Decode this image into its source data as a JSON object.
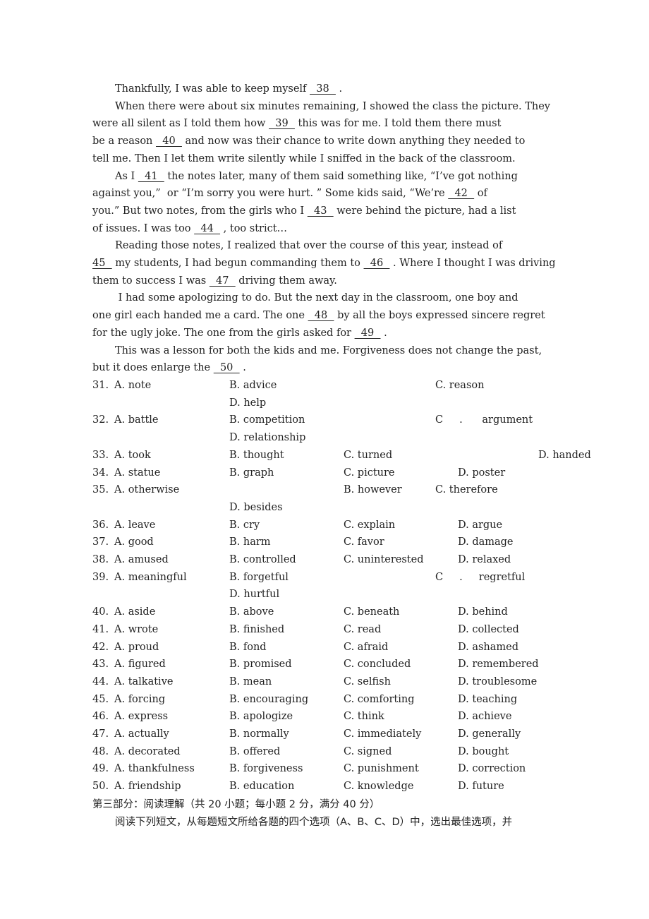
{
  "passage": {
    "lines": [
      {
        "indent": true,
        "parts": [
          "Thankfully, I was able to keep myself ",
          "  38  ",
          " ."
        ]
      },
      {
        "indent": true,
        "parts": [
          "When there were about six minutes remaining, I showed the class the picture. They"
        ]
      },
      {
        "indent": false,
        "parts": [
          "were all silent as I told them how ",
          "  39  ",
          " this was for me. I told them there must"
        ]
      },
      {
        "indent": false,
        "parts": [
          "be a reason ",
          "  40  ",
          " and now was their chance to write down anything they needed to"
        ]
      },
      {
        "indent": false,
        "parts": [
          "tell me. Then I let them write silently while I sniffed in the back of the classroom."
        ]
      },
      {
        "indent": true,
        "parts": [
          "As I ",
          "  41  ",
          " the notes later, many of them said something like, “I’ve got nothing"
        ]
      },
      {
        "indent": false,
        "parts": [
          "against you,”  or “I’m sorry you were hurt. ” Some kids said, “We’re ",
          "  42  ",
          " of"
        ]
      },
      {
        "indent": false,
        "parts": [
          "you.” But two notes, from the girls who I ",
          "  43  ",
          " were behind the picture, had a list"
        ]
      },
      {
        "indent": false,
        "parts": [
          "of issues. I was too ",
          "  44  ",
          " , too strict…"
        ]
      },
      {
        "indent": true,
        "parts": [
          "Reading those notes, I realized that over the course of this year, instead of"
        ]
      },
      {
        "indent": false,
        "parts": [
          "",
          "45  ",
          " my students, I had begun commanding them to ",
          "  46  ",
          " . Where I thought I was driving"
        ]
      },
      {
        "indent": false,
        "parts": [
          "them to success I was ",
          "  47  ",
          " driving them away."
        ]
      },
      {
        "indent": true,
        "parts": [
          " I had some apologizing to do. But the next day in the classroom, one boy and"
        ]
      },
      {
        "indent": false,
        "parts": [
          "one girl each handed me a card. The one ",
          "  48  ",
          " by all the boys expressed sincere regret"
        ]
      },
      {
        "indent": false,
        "parts": [
          "for the ugly joke. The one from the girls asked for ",
          "  49  ",
          " ."
        ]
      },
      {
        "indent": true,
        "parts": [
          "This was a lesson for both the kids and me. Forgiveness does not change the past,"
        ]
      },
      {
        "indent": false,
        "parts": [
          "but it does enlarge the ",
          "  50  ",
          " ."
        ]
      }
    ]
  },
  "questions": [
    {
      "num": "31.",
      "A": "A. note",
      "B": "B. advice",
      "C": "C. reason",
      "D": "D. help",
      "layout": "wrapCD"
    },
    {
      "num": "32.",
      "A": "A. battle",
      "B": "B. competition",
      "C": "C     .      argument",
      "D": "D. relationship",
      "layout": "wrapCD"
    },
    {
      "num": "33.",
      "A": "A. took",
      "B": "B. thought",
      "C": "C. turned",
      "D": "D. handed",
      "layout": "farD"
    },
    {
      "num": "34.",
      "A": "A. statue",
      "B": "B. graph",
      "C": "C. picture",
      "D": "D. poster",
      "layout": "normal"
    },
    {
      "num": "35.",
      "A": "A. otherwise",
      "B": "B. however",
      "C": "C. therefore",
      "D": "D. besides",
      "layout": "shiftB"
    },
    {
      "num": "36.",
      "A": "A. leave",
      "B": "B. cry",
      "C": "C. explain",
      "D": "D. argue",
      "layout": "normal"
    },
    {
      "num": "37.",
      "A": "A. good",
      "B": "B. harm",
      "C": "C. favor",
      "D": "D. damage",
      "layout": "normal"
    },
    {
      "num": "38.",
      "A": "A. amused",
      "B": "B. controlled",
      "C": "C. uninterested",
      "D": "D. relaxed",
      "layout": "normal"
    },
    {
      "num": "39.",
      "A": "A. meaningful",
      "B": "B. forgetful",
      "C": "C     .     regretful",
      "D": "D. hurtful",
      "layout": "wrapCD"
    },
    {
      "num": "40.",
      "A": "A. aside",
      "B": "B. above",
      "C": "C. beneath",
      "D": "D. behind",
      "layout": "normal"
    },
    {
      "num": "41.",
      "A": "A. wrote",
      "B": "B. finished",
      "C": "C. read",
      "D": "D. collected",
      "layout": "normal"
    },
    {
      "num": "42.",
      "A": "A. proud",
      "B": "B. fond",
      "C": "C. afraid",
      "D": "D. ashamed",
      "layout": "normal"
    },
    {
      "num": "43.",
      "A": "A. figured",
      "B": "B. promised",
      "C": "C. concluded",
      "D": "D. remembered",
      "layout": "normal"
    },
    {
      "num": "44.",
      "A": "A. talkative",
      "B": "B. mean",
      "C": "C. selfish",
      "D": "D. troublesome",
      "layout": "normal"
    },
    {
      "num": "45.",
      "A": "A. forcing",
      "B": "B. encouraging",
      "C": "C. comforting",
      "D": "D. teaching",
      "layout": "normal"
    },
    {
      "num": "46.",
      "A": "A. express",
      "B": "B. apologize",
      "C": "C. think",
      "D": "D. achieve",
      "layout": "normal"
    },
    {
      "num": "47.",
      "A": "A. actually",
      "B": "B. normally",
      "C": "C. immediately",
      "D": "D. generally",
      "layout": "normal"
    },
    {
      "num": "48.",
      "A": "A. decorated",
      "B": "B. offered",
      "C": "C. signed",
      "D": "D. bought",
      "layout": "normal"
    },
    {
      "num": "49.",
      "A": "A. thankfulness",
      "B": "B. forgiveness",
      "C": "C. punishment",
      "D": "D. correction",
      "layout": "normal"
    },
    {
      "num": "50.",
      "A": "A. friendship",
      "B": "B. education",
      "C": "C. knowledge",
      "D": "D. future",
      "layout": "normal"
    }
  ],
  "section": {
    "heading": "第三部分：阅读理解（共 20 小题；每小题 2 分，满分 40 分）",
    "instruction": "阅读下列短文，从每题短文所给各题的四个选项（A、B、C、D）中，选出最佳选项，并"
  }
}
